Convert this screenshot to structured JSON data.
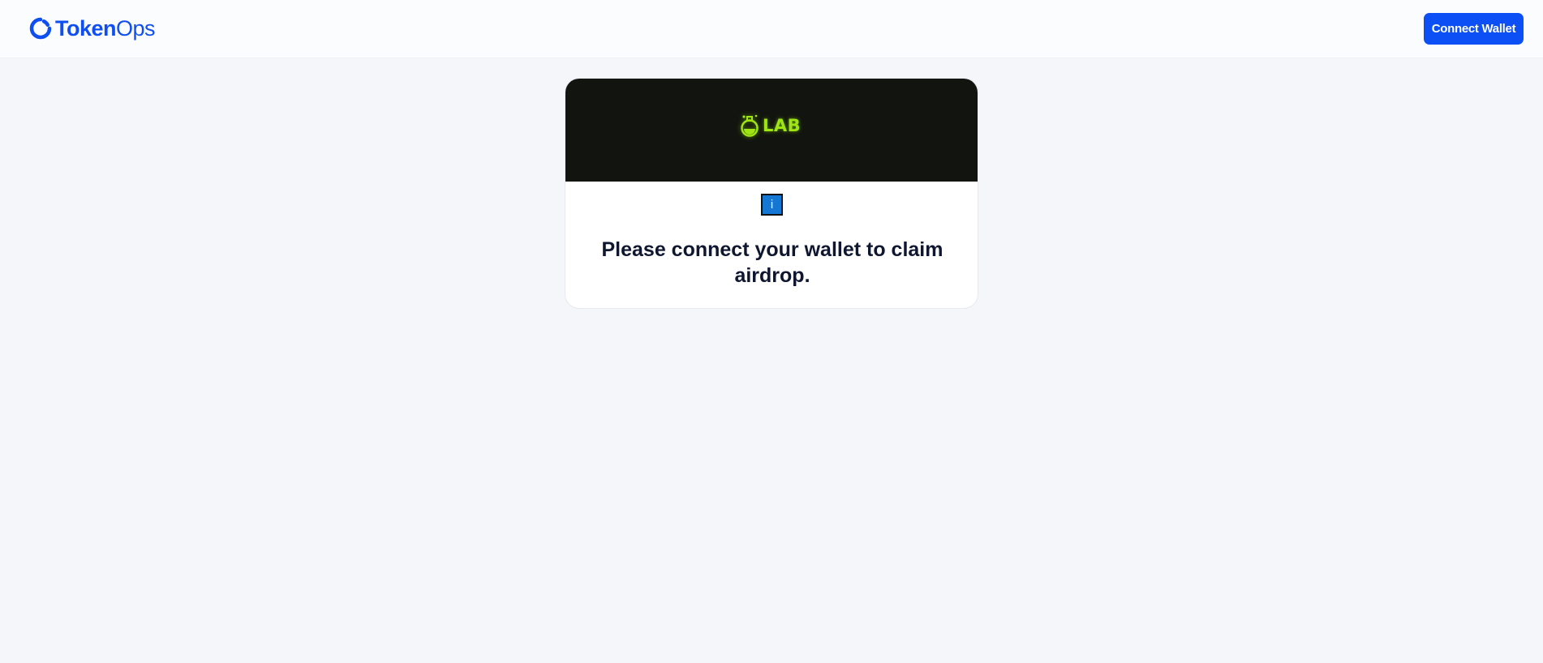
{
  "header": {
    "brand": {
      "part1": "Token",
      "part2": "Ops",
      "color": "#0f4ff2"
    },
    "connect_wallet_label": "Connect Wallet",
    "connect_wallet_color": "#0b4ff5"
  },
  "card": {
    "banner_logo_text": "LAB",
    "banner_logo_color": "#9fe514",
    "banner_background": "#12150f",
    "info_icon_glyph": "i",
    "message": "Please connect your wallet to claim airdrop."
  }
}
